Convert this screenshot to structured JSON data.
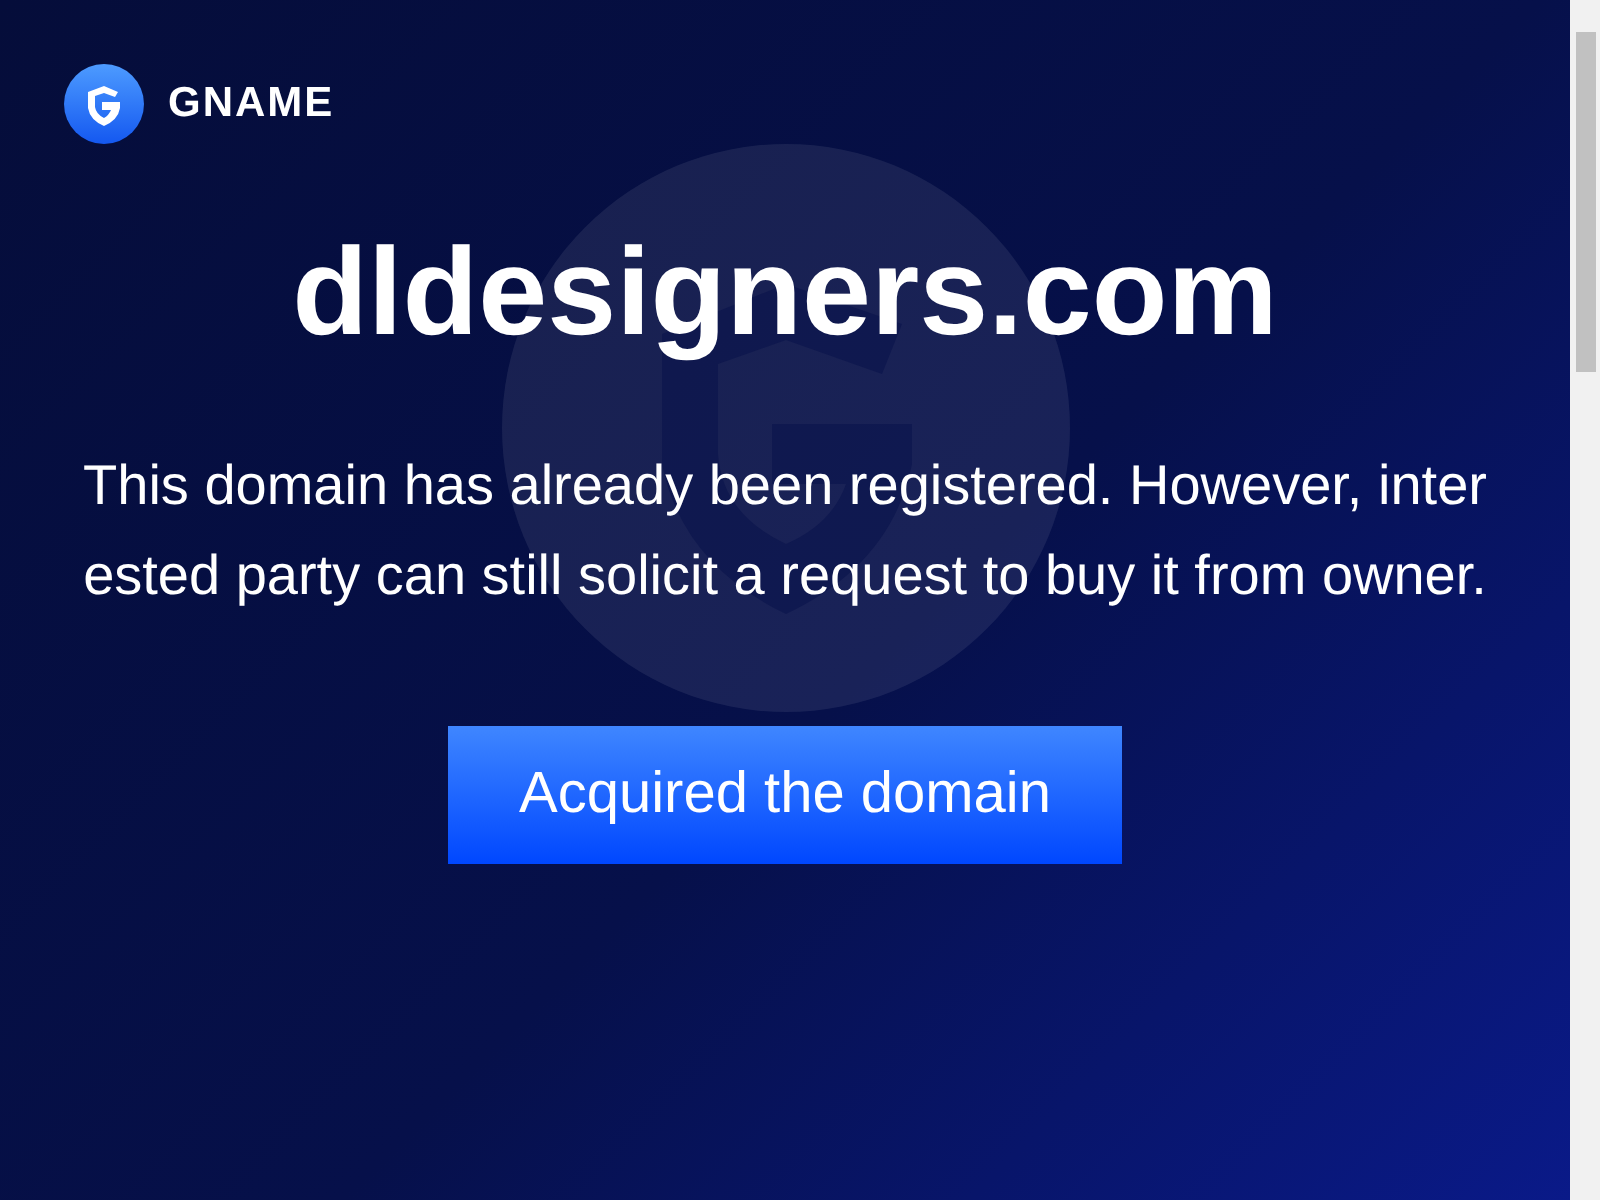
{
  "logo": {
    "text": "GNAME"
  },
  "domain": "dldesigners.com",
  "message": "This domain has already been registered. However, interested party can still solicit a request to buy it from owner.",
  "button": "Acquired the domain"
}
